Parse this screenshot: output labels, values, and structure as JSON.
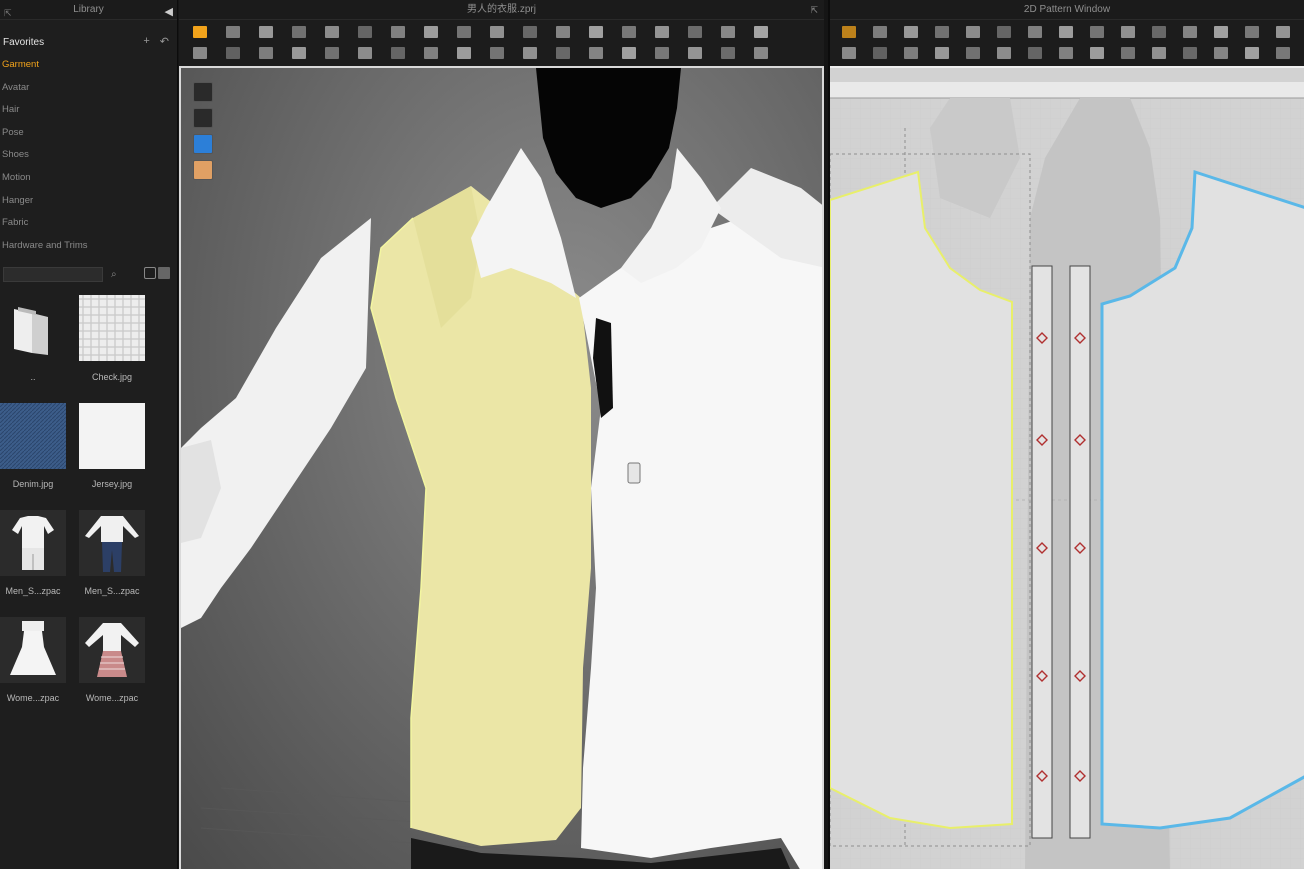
{
  "library": {
    "title": "Library",
    "favorites_label": "Favorites",
    "add_symbol": "+",
    "back_symbol": "↶",
    "categories": [
      {
        "label": "Garment",
        "active": true
      },
      {
        "label": "Avatar",
        "active": false
      },
      {
        "label": "Hair",
        "active": false
      },
      {
        "label": "Pose",
        "active": false
      },
      {
        "label": "Shoes",
        "active": false
      },
      {
        "label": "Motion",
        "active": false
      },
      {
        "label": "Hanger",
        "active": false
      },
      {
        "label": "Fabric",
        "active": false
      },
      {
        "label": "Hardware and Trims",
        "active": false
      }
    ],
    "search": {
      "value": "",
      "placeholder": ""
    },
    "items": [
      {
        "label": "..",
        "icon": "folder-icon"
      },
      {
        "label": "Check.jpg",
        "icon": "check-fabric-thumbnail"
      },
      {
        "label": "Denim.jpg",
        "icon": "denim-fabric-thumbnail"
      },
      {
        "label": "Jersey.jpg",
        "icon": "jersey-fabric-thumbnail"
      },
      {
        "label": "Men_S...zpac",
        "icon": "men-shirt-shorts-thumbnail"
      },
      {
        "label": "Men_S...zpac",
        "icon": "men-shirt-pants-thumbnail"
      },
      {
        "label": "Wome...zpac",
        "icon": "women-dress-thumbnail"
      },
      {
        "label": "Wome...zpac",
        "icon": "women-blouse-skirt-thumbnail"
      }
    ]
  },
  "window3d": {
    "title": "男人的衣服.zprj"
  },
  "window2d": {
    "title": "2D Pattern Window"
  },
  "colors": {
    "accent": "#f2a31b",
    "selected_outline": "#e8ef6a",
    "pattern_outline": "#5ab8e8",
    "notch": "#b03030"
  }
}
